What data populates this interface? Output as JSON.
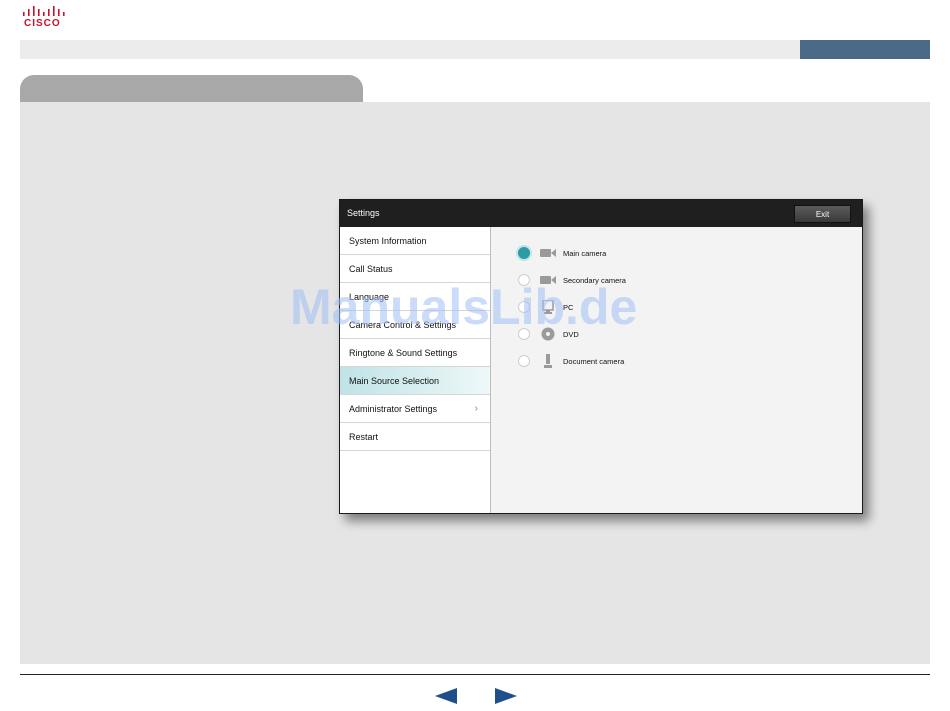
{
  "brand": {
    "logo_text": "CISCO",
    "accent": "#c8102e"
  },
  "colors": {
    "header_bar": "#4b6a87",
    "tab": "#a8a8a8",
    "content_bg": "#e5e5e5",
    "selected_radio": "#2e9aa5"
  },
  "dialog": {
    "title": "Settings",
    "exit_label": "Exit",
    "menu": [
      {
        "label": "System Information"
      },
      {
        "label": "Call Status"
      },
      {
        "label": "Language"
      },
      {
        "label": "Camera Control & Settings"
      },
      {
        "label": "Ringtone & Sound Settings"
      },
      {
        "label": "Main Source Selection"
      },
      {
        "label": "Administrator Settings"
      },
      {
        "label": "Restart"
      }
    ],
    "selected_menu": "Main Source Selection",
    "sources": [
      {
        "label": "Main camera",
        "icon": "camera-icon",
        "selected": true
      },
      {
        "label": "Secondary camera",
        "icon": "camera-icon",
        "selected": false
      },
      {
        "label": "PC",
        "icon": "pc-icon",
        "selected": false
      },
      {
        "label": "DVD",
        "icon": "dvd-icon",
        "selected": false
      },
      {
        "label": "Document camera",
        "icon": "document-camera-icon",
        "selected": false
      }
    ]
  },
  "watermark": "ManualsLib.de",
  "navigation": {
    "prev": "previous-page",
    "next": "next-page"
  }
}
